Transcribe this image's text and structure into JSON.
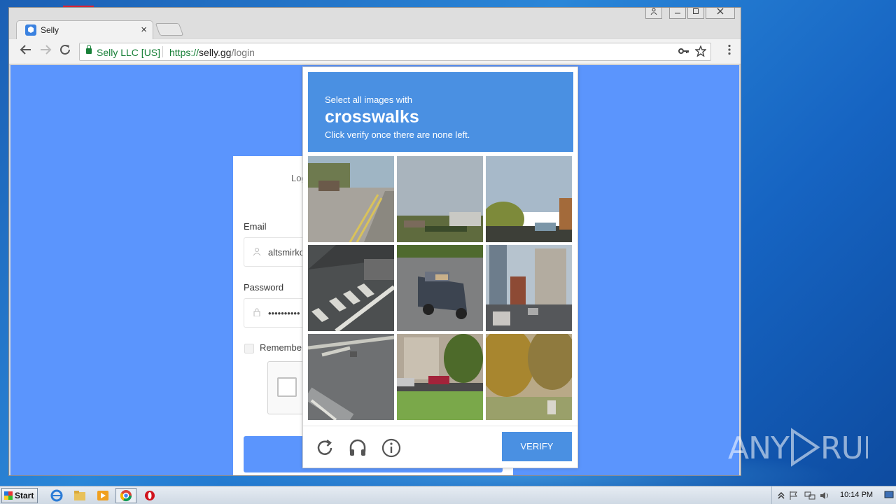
{
  "browser": {
    "tab_title": "Selly",
    "tab_close": "×",
    "site_identity": "Selly LLC [US]",
    "url_scheme": "https://",
    "url_host": "selly.gg",
    "url_path": "/login"
  },
  "page": {
    "login_title": "Log",
    "email_label": "Email",
    "email_value": "altsmirko",
    "password_label": "Password",
    "password_value": "••••••••••",
    "remember_label": "Remember"
  },
  "captcha": {
    "instruction_line1": "Select all images with",
    "keyword": "crosswalks",
    "instruction_line2": "Click verify once there are none left.",
    "verify_label": "VERIFY",
    "accent_color": "#4a90e2"
  },
  "taskbar": {
    "start_label": "Start",
    "clock": "10:14 PM"
  },
  "watermark": "ANY RUN"
}
